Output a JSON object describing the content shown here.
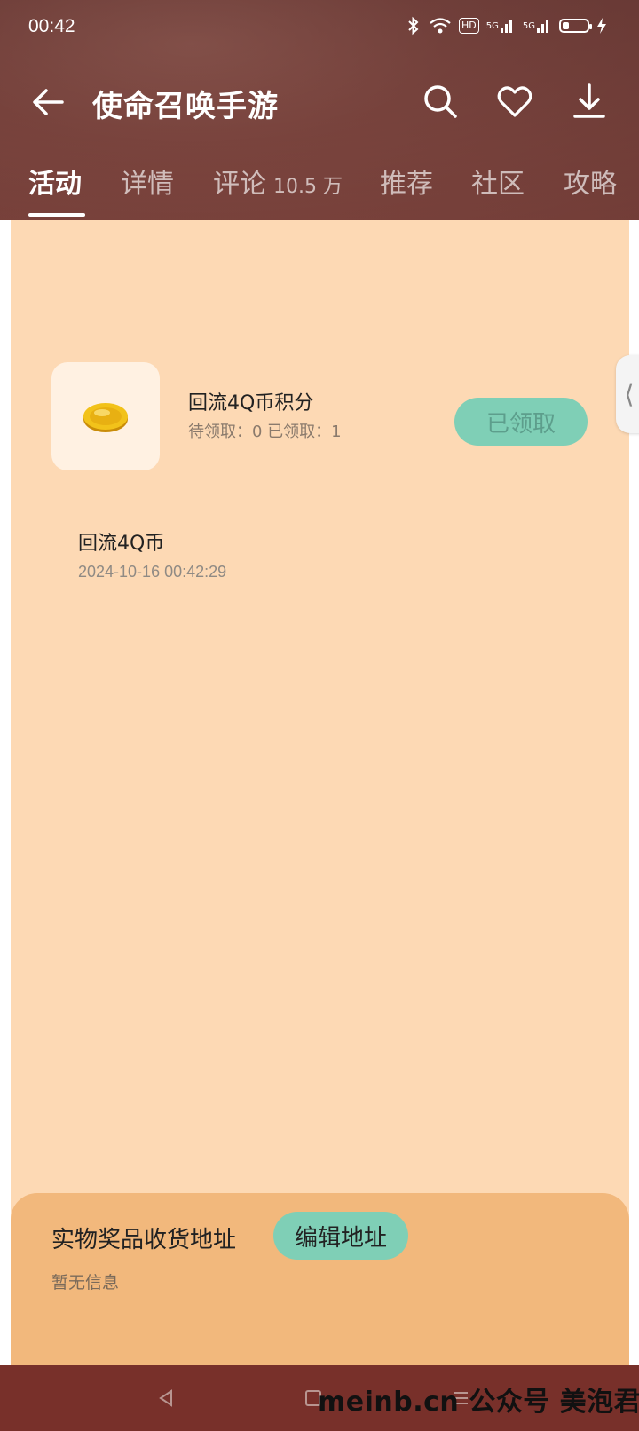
{
  "status_bar": {
    "time": "00:42",
    "hd": "HD",
    "sig1": "5G",
    "sig2": "5G"
  },
  "header": {
    "title": "使命召唤手游",
    "tabs": [
      {
        "label": "活动",
        "count": ""
      },
      {
        "label": "详情",
        "count": ""
      },
      {
        "label": "评论",
        "count": "10.5 万"
      },
      {
        "label": "推荐",
        "count": ""
      },
      {
        "label": "社区",
        "count": ""
      },
      {
        "label": "攻略",
        "count": ""
      }
    ]
  },
  "reward": {
    "title": "回流4Q币积分",
    "subtitle": "待领取：0 已领取：1",
    "button_label": "已领取",
    "icon": "gold-coin-icon"
  },
  "record": {
    "title": "回流4Q币",
    "time": "2024-10-16 00:42:29"
  },
  "address": {
    "label": "实物奖品收货地址",
    "edit_button": "编辑地址",
    "empty_text": "暂无信息"
  },
  "watermark": "meinb.cn 公众号 美泡君",
  "colors": {
    "header_bg": "#7a4640",
    "content_bg": "#fdd9b4",
    "accent_button": "#7fcfb6",
    "address_panel": "#f2b87c",
    "navbar": "#78302a"
  }
}
